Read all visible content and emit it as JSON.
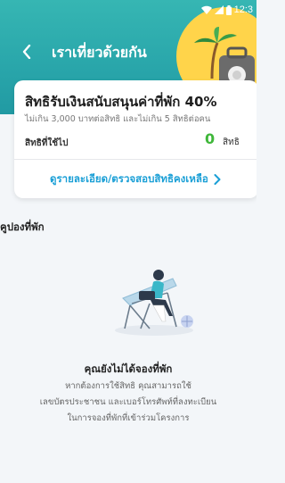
{
  "status_bar": {
    "time": "12:3"
  },
  "header": {
    "title": "เราเที่ยวด้วยกัน"
  },
  "card": {
    "title": "สิทธิรับเงินสนับสนุนค่าที่พัก 40%",
    "subtitle": "ไม่เกิน 3,000 บาทต่อสิทธิ และไม่เกิน 5 สิทธิต่อคน",
    "used_label": "สิทธิที่ใช้ไป",
    "used_value": "0",
    "used_unit": "สิทธิ",
    "detail_link": "ดูรายละเอียด/ตรวจสอบสิทธิคงเหลือ"
  },
  "coupons": {
    "section_title": "คูปองที่พัก",
    "empty_title": "คุณยังไม่ได้จองที่พัก",
    "empty_desc_line1": "หากต้องการใช้สิทธิ คุณสามารถใช้",
    "empty_desc_line2": "เลขบัตรประชาชน และเบอร์โทรศัพท์ที่ลงทะเบียน",
    "empty_desc_line3": "ในการจองที่พักที่เข้าร่วมโครงการ"
  },
  "colors": {
    "header_teal": "#2aa7ab",
    "used_value_green": "#3fb73a",
    "link_blue": "#1a9fd6",
    "deco_yellow": "#ffd44a"
  },
  "icons": [
    "wifi-icon",
    "signal-icon",
    "battery-icon",
    "back-arrow-icon",
    "chevron-right-icon",
    "palm-tree-icon",
    "travel-bag-icon",
    "beach-chair-illustration"
  ]
}
